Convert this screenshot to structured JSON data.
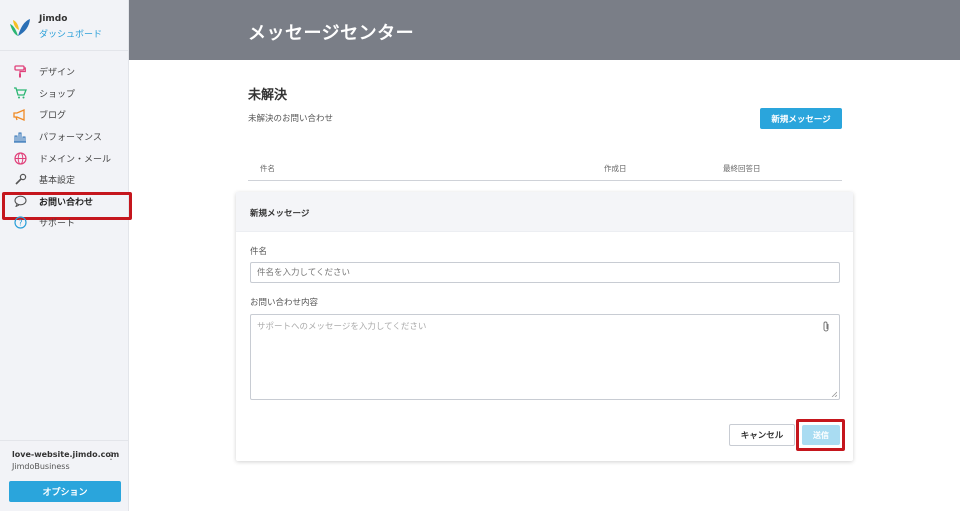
{
  "brand": {
    "name": "Jimdo",
    "dashboard": "ダッシュボード"
  },
  "sidebar": {
    "items": [
      {
        "label": "デザイン",
        "icon": "paint-roller-icon",
        "color": "#e0407a"
      },
      {
        "label": "ショップ",
        "icon": "cart-icon",
        "color": "#2bb673"
      },
      {
        "label": "ブログ",
        "icon": "megaphone-icon",
        "color": "#f08a24"
      },
      {
        "label": "パフォーマンス",
        "icon": "bar-chart-icon",
        "color": "#2a6fb5"
      },
      {
        "label": "ドメイン・メール",
        "icon": "globe-icon",
        "color": "#e0407a"
      },
      {
        "label": "基本設定",
        "icon": "wrench-icon",
        "color": "#555555"
      },
      {
        "label": "お問い合わせ",
        "icon": "chat-bubble-icon",
        "color": "#555555",
        "active": true
      },
      {
        "label": "サポート",
        "icon": "help-circle-icon",
        "color": "#2a9fd8"
      }
    ]
  },
  "site": {
    "url": "love-website.jimdo.com",
    "plan": "JimdoBusiness",
    "option_label": "オプション"
  },
  "header": {
    "title": "メッセージセンター"
  },
  "main": {
    "section_title": "未解決",
    "section_subtitle": "未解決のお問い合わせ",
    "new_message_label": "新規メッセージ",
    "columns": [
      "件名",
      "作成日",
      "最終回答日"
    ]
  },
  "form": {
    "title": "新規メッセージ",
    "subject_label": "件名",
    "subject_placeholder": "件名を入力してください",
    "body_label": "お問い合わせ内容",
    "body_placeholder": "サポートへのメッセージを入力してください",
    "cancel_label": "キャンセル",
    "send_label": "送信"
  },
  "colors": {
    "accent": "#2aa5dc",
    "header_bg": "#7a7e87",
    "highlight": "#c5161d"
  }
}
